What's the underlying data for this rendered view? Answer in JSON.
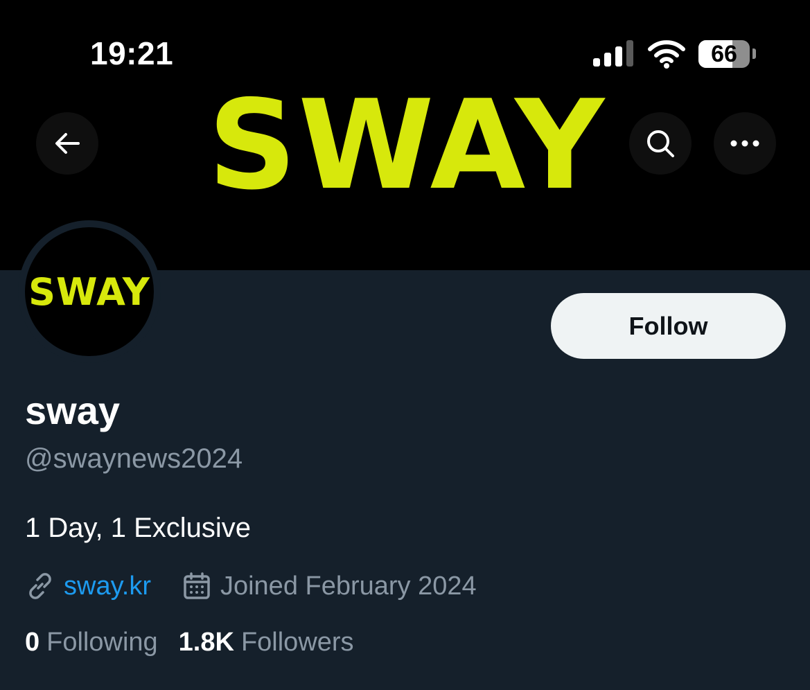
{
  "status_bar": {
    "time": "19:21",
    "battery": "66",
    "battery_level_percent": 66
  },
  "banner": {
    "logo_text": "SWAY",
    "logo_color": "#d7e80c",
    "background": "#000000"
  },
  "nav": {
    "back_icon": "arrow-left-icon",
    "search_icon": "search-icon",
    "more_icon": "more-horizontal-icon"
  },
  "profile": {
    "avatar_text": "SWAY",
    "display_name": "sway",
    "handle": "@swaynews2024",
    "bio": "1 Day, 1 Exclusive",
    "website": "sway.kr",
    "joined": "Joined February 2024",
    "follow_label": "Follow"
  },
  "stats": {
    "following_count": "0",
    "following_label": "Following",
    "followers_count": "1.8K",
    "followers_label": "Followers"
  },
  "colors": {
    "background": "#15202b",
    "secondary_text": "#8b98a5",
    "link": "#1d9bf0",
    "follow_button_bg": "#eff3f4"
  }
}
